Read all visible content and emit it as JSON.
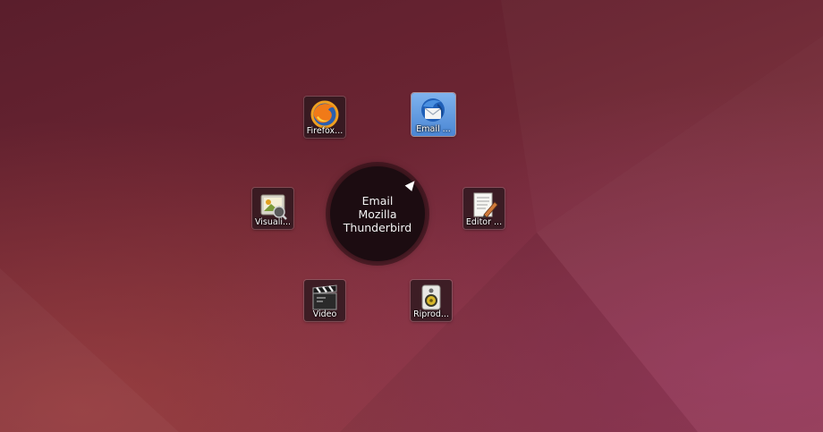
{
  "desktop": {
    "background": "Ubuntu warm red-purple gradient"
  },
  "launcher": {
    "center": {
      "lines": [
        "Email",
        "Mozilla",
        "Thunderbird"
      ]
    },
    "items": [
      {
        "label": "Firefox...",
        "icon": "firefox-icon"
      },
      {
        "label": "Email ...",
        "icon": "thunderbird-icon",
        "selected": true
      },
      {
        "label": "Visuali...",
        "icon": "image-viewer-icon"
      },
      {
        "label": "Editor ...",
        "icon": "text-editor-icon"
      },
      {
        "label": "Video",
        "icon": "video-clapperboard-icon"
      },
      {
        "label": "Riprod...",
        "icon": "speaker-icon"
      }
    ]
  },
  "colors": {
    "selection": "#5b93dc",
    "hub": "#1c0c11",
    "tile": "#2d191e"
  }
}
